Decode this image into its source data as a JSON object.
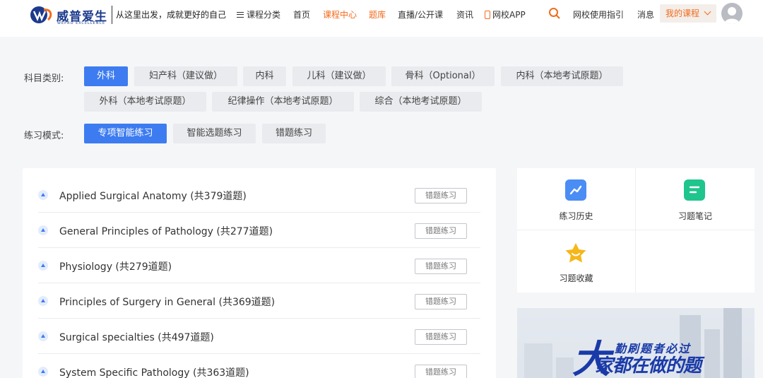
{
  "header": {
    "brand": "威普爱生",
    "brand_en": "WEPRO EXCELLENCE",
    "slogan": "从这里出发，成就更好的自己",
    "nav": [
      {
        "label": "课程分类"
      },
      {
        "label": "首页"
      },
      {
        "label": "课程中心"
      },
      {
        "label": "题库"
      },
      {
        "label": "直播/公开课"
      },
      {
        "label": "资讯"
      },
      {
        "label": "网校APP"
      },
      {
        "label": "网校使用指引"
      },
      {
        "label": "消息"
      }
    ],
    "my_course": "我的课程",
    "colors": {
      "accent": "#f26b1d",
      "primary": "#3d7cf0",
      "brand": "#1b3a8c"
    }
  },
  "filters": {
    "subject_label": "科目类别:",
    "subjects": [
      "外科",
      "妇产科（建议做）",
      "内科",
      "儿科（建议做）",
      "骨科（Optional）",
      "内科（本地考试原题）",
      "外科（本地考试原题）",
      "纪律操作（本地考试原题）",
      "综合（本地考试原题）"
    ],
    "active_subject": "外科",
    "mode_label": "练习模式:",
    "modes": [
      "专项智能练习",
      "智能选题练习",
      "错题练习"
    ],
    "active_mode": "专项智能练习"
  },
  "list": {
    "rows": [
      {
        "title": "Applied Surgical Anatomy (共379道题)",
        "button": "错题练习"
      },
      {
        "title": "General Principles of Pathology (共277道题)",
        "button": "错题练习"
      },
      {
        "title": "Physiology (共279道题)",
        "button": "错题练习"
      },
      {
        "title": "Principles of Surgery in General (共369道题)",
        "button": "错题练习"
      },
      {
        "title": "Surgical specialties (共497道题)",
        "button": "错题练习"
      },
      {
        "title": "System Specific Pathology (共363道题)",
        "button": "错题练习"
      }
    ]
  },
  "tools": {
    "items": [
      {
        "label": "练习历史",
        "icon": "chart-trend-icon",
        "color": "#4a8df5"
      },
      {
        "label": "习题笔记",
        "icon": "notes-icon",
        "color": "#1fc58c"
      },
      {
        "label": "习题收藏",
        "icon": "star-icon",
        "color": "#f5b71a"
      }
    ]
  },
  "banner": {
    "slogan": "勤刷题者必过",
    "big_text": "家都在做的题",
    "first_char": "大"
  }
}
